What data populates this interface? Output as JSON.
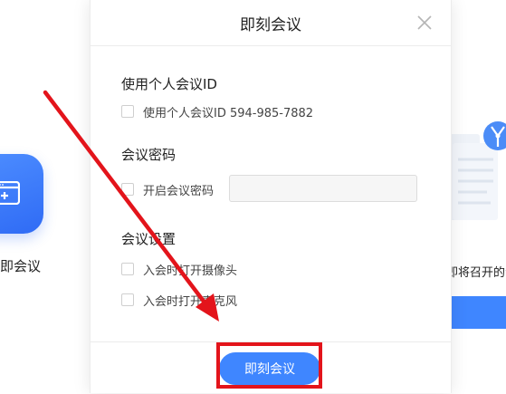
{
  "background": {
    "left_app_label": "即会议",
    "right_app_text": "即将召开的会"
  },
  "dialog": {
    "title": "即刻会议",
    "close_icon": "close-icon",
    "sections": {
      "personal_id": {
        "title": "使用个人会议ID",
        "checkbox_label": "使用个人会议ID 594-985-7882",
        "checked": false
      },
      "password": {
        "title": "会议密码",
        "checkbox_label": "开启会议密码",
        "checked": false,
        "input_value": ""
      },
      "settings": {
        "title": "会议设置",
        "camera_label": "入会时打开摄像头",
        "camera_checked": false,
        "mic_label": "入会时打开麦克风",
        "mic_checked": false
      }
    },
    "primary_button_label": "即刻会议"
  },
  "annotations": {
    "arrow_color": "#e3141b",
    "highlight_color": "#e3141b"
  },
  "colors": {
    "accent": "#3f86ff"
  }
}
